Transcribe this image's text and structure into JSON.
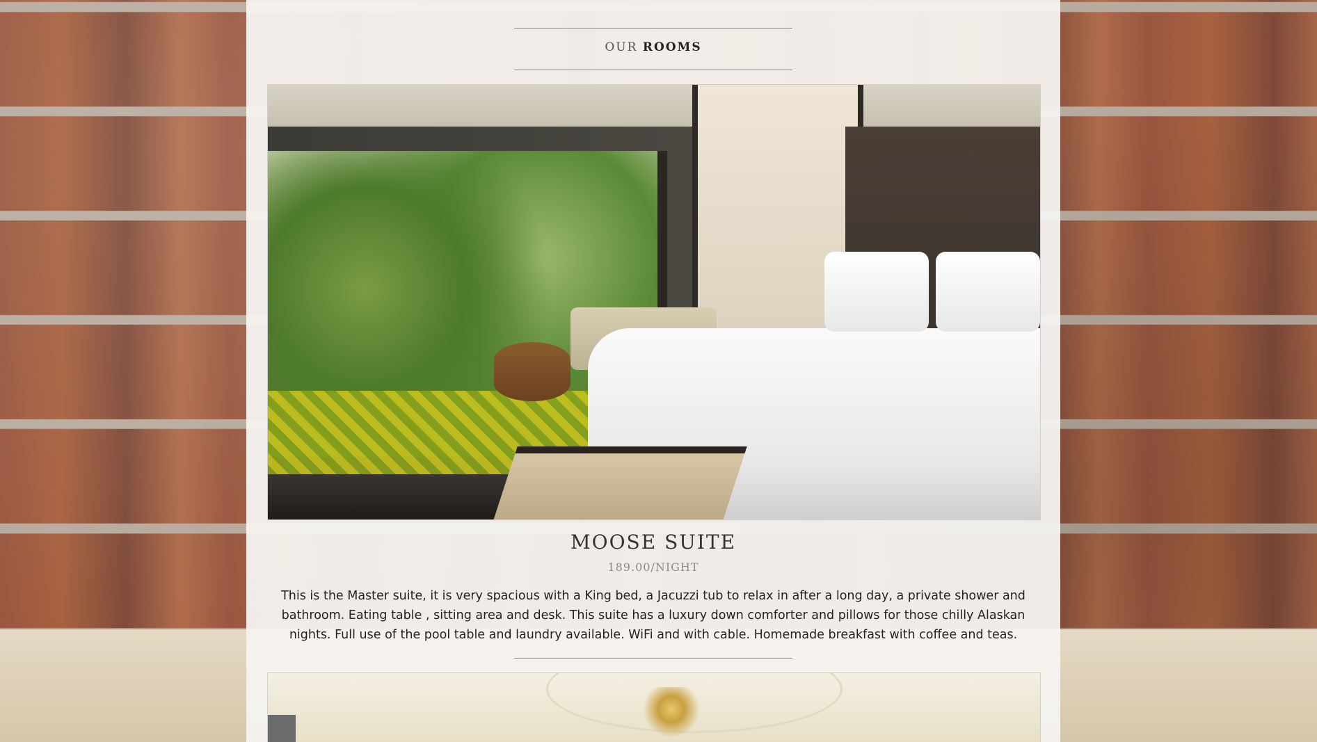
{
  "section": {
    "title_light": "OUR",
    "title_strong": "ROOMS"
  },
  "rooms": [
    {
      "name": "MOOSE SUITE",
      "price": "189.00/NIGHT",
      "description": "This is the Master suite, it is very spacious with a King bed, a Jacuzzi tub to relax in after a long day, a private shower and bathroom. Eating table , sitting area and desk. This suite has a luxury down comforter and pillows for those chilly Alaskan nights. Full use of the pool table and laundry available. WiFi and with cable. Homemade breakfast with coffee and teas."
    }
  ]
}
